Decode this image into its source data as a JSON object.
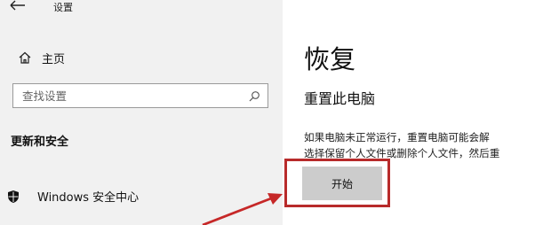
{
  "window": {
    "title": "设置"
  },
  "sidebar": {
    "home_label": "主页",
    "section_title": "更新和安全",
    "items": [
      {
        "label": "Windows 安全中心",
        "icon": "shield-icon"
      }
    ]
  },
  "search": {
    "placeholder": "查找设置"
  },
  "main": {
    "page_title": "恢复",
    "subtitle": "重置此电脑",
    "description_lines": [
      "如果电脑未正常运行，重置电脑可能会解",
      "选择保留个人文件或删除个人文件，然后重"
    ],
    "start_button_label": "开始"
  },
  "colors": {
    "sidebar_bg": "#f1f1f1",
    "button_bg": "#cccccc",
    "annotation_red": "#b82b2b"
  }
}
